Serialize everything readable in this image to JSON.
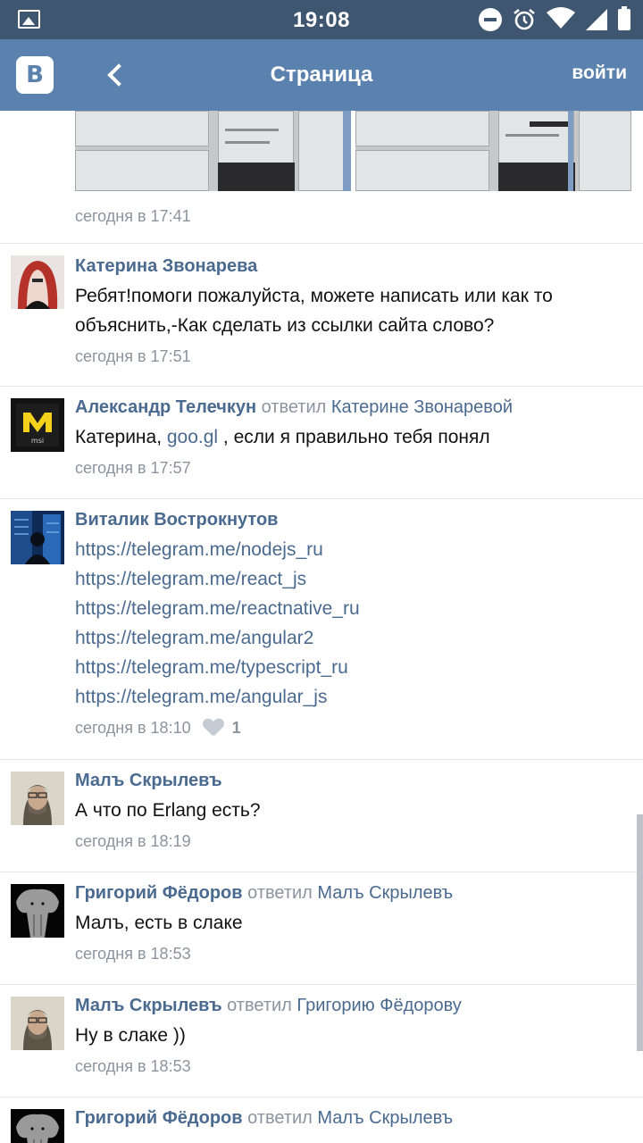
{
  "status_bar": {
    "time": "19:08",
    "icons": [
      "gallery-icon",
      "do-not-disturb-icon",
      "alarm-icon",
      "wifi-icon",
      "signal-icon",
      "battery-icon"
    ]
  },
  "header": {
    "logo": "B",
    "title": "Страница",
    "login_label": "войти",
    "bg_color": "#5b82ae"
  },
  "first_post": {
    "time": "сегодня в 17:41"
  },
  "comments": [
    {
      "author": "Катерина Звонарева",
      "text": "Ребят!помоги пожалуйста, можете написать или как то объяснить,-Как сделать из ссылки сайта слово?",
      "time": "сегодня в 17:51"
    },
    {
      "author": "Александр Телечкун",
      "replied_label": "ответил",
      "reply_to": "Катерине Звонаревой",
      "text_prefix": "Катерина, ",
      "text_link": "goo.gl",
      "text_suffix": " , если я правильно тебя понял",
      "time": "сегодня в 17:57"
    },
    {
      "author": "Виталик Вострокнутов",
      "links": [
        "https://telegram.me/nodejs_ru",
        "https://telegram.me/react_js",
        "https://telegram.me/reactnative_ru",
        "https://telegram.me/angular2",
        "https://telegram.me/typescript_ru",
        "https://telegram.me/angular_js"
      ],
      "time": "сегодня в 18:10",
      "likes": "1"
    },
    {
      "author": "Малъ Скрылевъ",
      "text": "А что по Erlang есть?",
      "time": "сегодня в 18:19"
    },
    {
      "author": "Григорий Фёдоров",
      "replied_label": "ответил",
      "reply_to": "Малъ Скрылевъ",
      "text": "Малъ, есть в слаке",
      "time": "сегодня в 18:53"
    },
    {
      "author": "Малъ Скрылевъ",
      "replied_label": "ответил",
      "reply_to": "Григорию Фёдорову",
      "text": "Ну в слаке ))",
      "time": "сегодня в 18:53"
    },
    {
      "author": "Григорий Фёдоров",
      "replied_label": "ответил",
      "reply_to": "Малъ Скрылевъ"
    }
  ]
}
